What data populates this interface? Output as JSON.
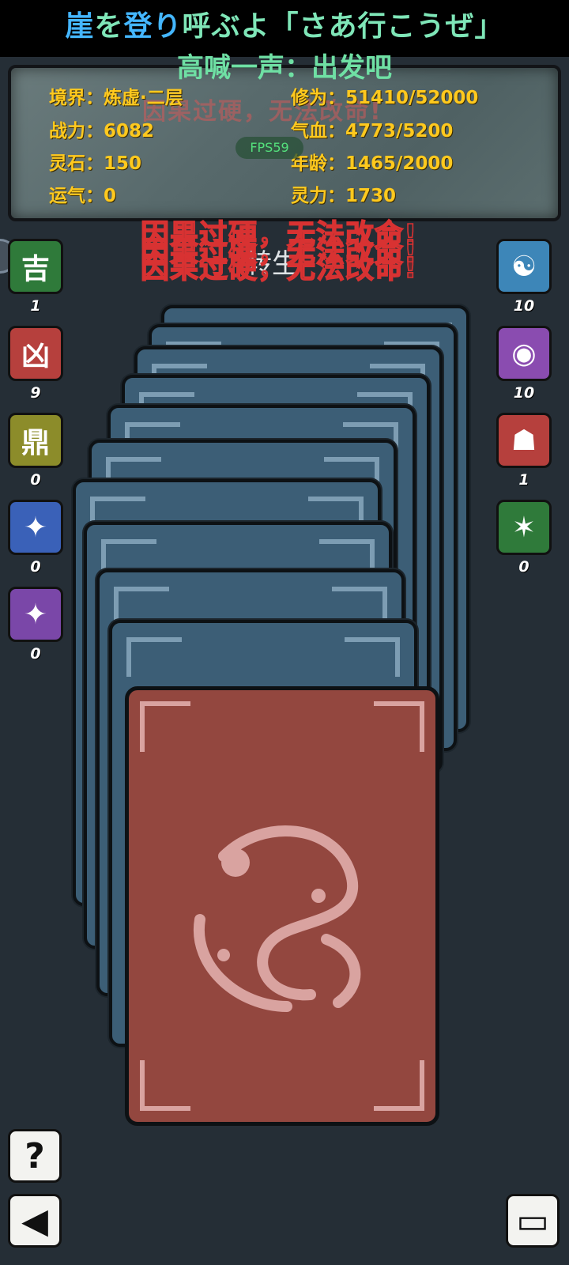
{
  "lyrics": {
    "line1_hl1": "崖",
    "line1_a": "を",
    "line1_hl2": "登り",
    "line1_b": "呼ぶよ「さあ行こうぜ」",
    "line2": "高喊一声：出发吧"
  },
  "stats": {
    "realm": "境界：炼虚·二层",
    "power": "战力：6082",
    "spirit_stone": "灵石：150",
    "luck": "运气：0",
    "cultivation": "修为：51410/52000",
    "hp": "气血：4773/5200",
    "age": "年龄：1465/2000",
    "spirit_power": "灵力：1730"
  },
  "overlay": {
    "ghost_warning": "因果过硬，无法改命!",
    "fps": "FPS59",
    "warning": "因果过硬，无法改命!",
    "center_title": "转生"
  },
  "left_items": [
    {
      "icon": "ji-auspicious-icon",
      "glyph": "吉",
      "count": "1",
      "bg": "#2f7a3a"
    },
    {
      "icon": "xiong-ominous-icon",
      "glyph": "凶",
      "count": "9",
      "bg": "#b6403d"
    },
    {
      "icon": "green-cauldron-icon",
      "glyph": "鼎",
      "count": "0",
      "bg": "#8c8c2a"
    },
    {
      "icon": "fire-scroll-icon",
      "glyph": "✦",
      "count": "0",
      "bg": "#3a61b8"
    },
    {
      "icon": "water-scroll-icon",
      "glyph": "✦",
      "count": "0",
      "bg": "#7a47a8"
    }
  ],
  "right_items": [
    {
      "icon": "bagua-compass-icon",
      "glyph": "☯",
      "count": "10",
      "bg": "#3d86b8"
    },
    {
      "icon": "green-orb-icon",
      "glyph": "◉",
      "count": "10",
      "bg": "#8a4cb0"
    },
    {
      "icon": "hooded-figure-icon",
      "glyph": "☗",
      "count": "1",
      "bg": "#b6403d"
    },
    {
      "icon": "altar-talisman-icon",
      "glyph": "✶",
      "count": "0",
      "bg": "#2f7a3a"
    }
  ],
  "buttons": {
    "help": "?",
    "back": "◀",
    "save": "▭"
  },
  "colors": {
    "stat_text": "#ffc91e",
    "card_back": "#3c5e76",
    "card_front": "#93473f"
  }
}
